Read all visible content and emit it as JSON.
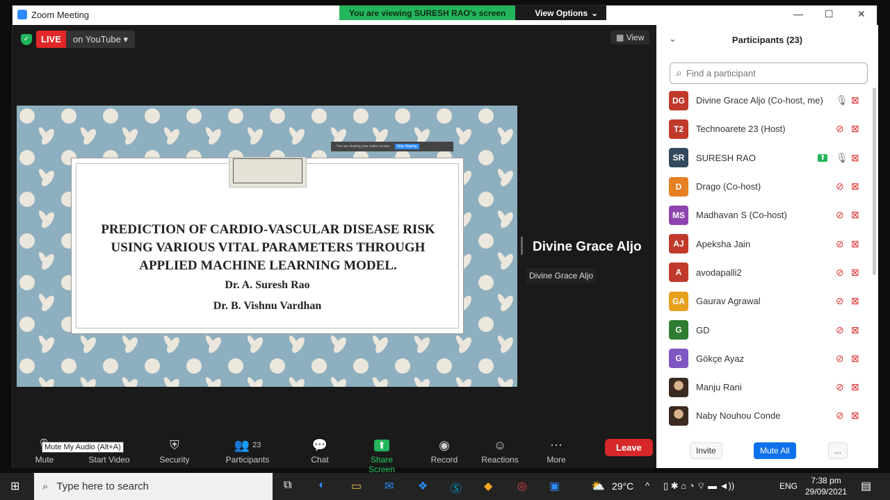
{
  "window": {
    "title": "Zoom Meeting",
    "viewing": "You are viewing SURESH RAO's screen",
    "view_options": "View Options"
  },
  "stage": {
    "live": "LIVE",
    "live_on": "on YouTube",
    "view": "View"
  },
  "slide": {
    "share_msg": "You are sharing your entire screen.",
    "stop_sharing": "Stop Sharing",
    "title": "PREDICTION OF CARDIO-VASCULAR DISEASE RISK USING VARIOUS VITAL PARAMETERS THROUGH APPLIED MACHINE LEARNING MODEL.",
    "author1": "Dr. A. Suresh Rao",
    "author2": "Dr. B. Vishnu Vardhan"
  },
  "speaker": {
    "name": "Divine Grace Aljo",
    "tooltip": "Divine Grace Aljo"
  },
  "toolbar": {
    "mute": "Mute",
    "mute_tip": "Mute My Audio (Alt+A)",
    "video": "Start Video",
    "security": "Security",
    "participants": "Participants",
    "participants_count": "23",
    "chat": "Chat",
    "share": "Share Screen",
    "record": "Record",
    "reactions": "Reactions",
    "more": "More",
    "leave": "Leave"
  },
  "panel": {
    "title": "Participants (23)",
    "search_placeholder": "Find a participant",
    "invite": "Invite",
    "mute_all": "Mute All",
    "more": "...",
    "participants": [
      {
        "initials": "DG",
        "name": "Divine Grace Aljo (Co-host, me)",
        "color": "#c0392b",
        "mic": "on"
      },
      {
        "initials": "T2",
        "name": "Technoarete 23 (Host)",
        "color": "#c0392b",
        "mic": "off"
      },
      {
        "initials": "SR",
        "name": "SURESH RAO",
        "color": "#34495e",
        "mic": "on",
        "sharing": true
      },
      {
        "initials": "D",
        "name": "Drago (Co-host)",
        "color": "#e67e22",
        "mic": "off"
      },
      {
        "initials": "MS",
        "name": "Madhavan S (Co-host)",
        "color": "#8e44ad",
        "mic": "off"
      },
      {
        "initials": "AJ",
        "name": "Apeksha Jain",
        "color": "#c0392b",
        "mic": "off"
      },
      {
        "initials": "A",
        "name": "avodapalli2",
        "color": "#c0392b",
        "mic": "off"
      },
      {
        "initials": "GA",
        "name": "Gaurav Agrawal",
        "color": "#e6a01e",
        "mic": "off"
      },
      {
        "initials": "G",
        "name": "GD",
        "color": "#2e7d32",
        "mic": "off"
      },
      {
        "initials": "G",
        "name": "Gökçe Ayaz",
        "color": "#7e57c2",
        "mic": "off"
      },
      {
        "initials": "",
        "name": "Manju Rani",
        "color": "#6d4c41",
        "mic": "off",
        "photo": true
      },
      {
        "initials": "",
        "name": "Naby Nouhou Conde",
        "color": "#333",
        "mic": "off",
        "photo": true
      }
    ]
  },
  "taskbar": {
    "search": "Type here to search",
    "weather": "29°C",
    "lang": "ENG",
    "time": "7:38 pm",
    "date": "29/09/2021"
  },
  "colors": {
    "accent": "#2d8cff",
    "live_red": "#e02828",
    "share_green": "#23b55b",
    "leave_red": "#d62828"
  }
}
